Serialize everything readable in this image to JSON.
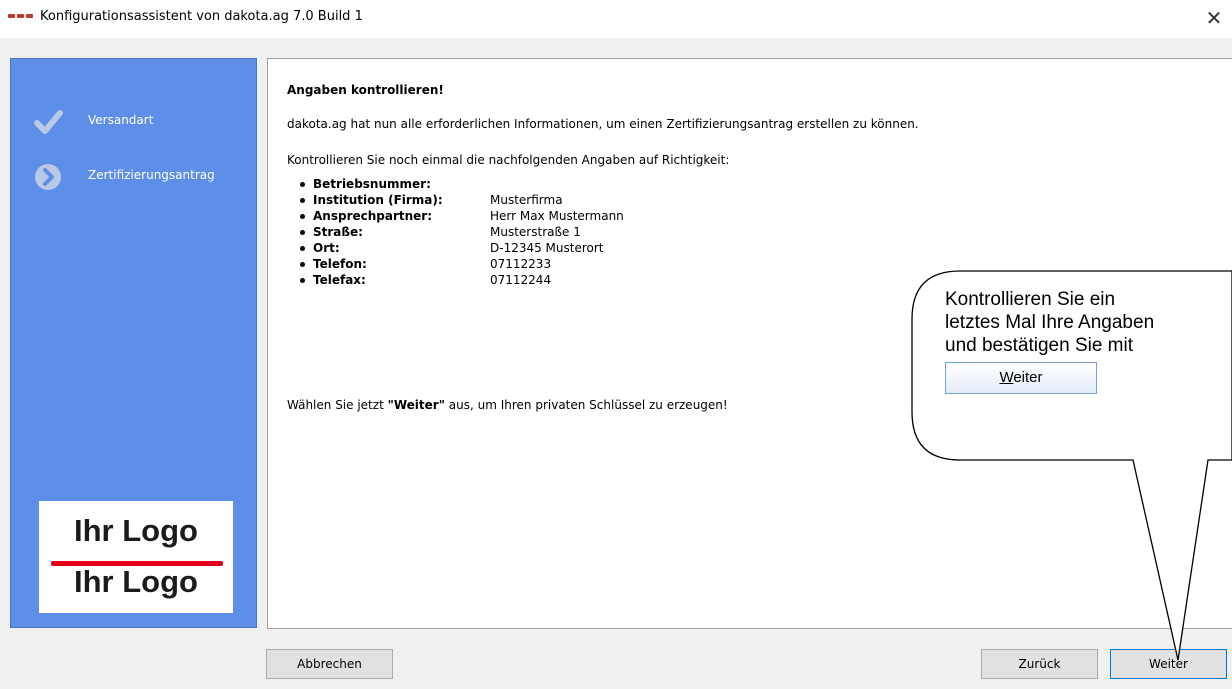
{
  "window": {
    "title": "Konfigurationsassistent von dakota.ag 7.0 Build 1",
    "close_glyph": "✕"
  },
  "sidebar": {
    "steps": [
      {
        "label": "Versandart",
        "state": "done",
        "icon": "checkmark-icon"
      },
      {
        "label": "Zertifizierungsantrag",
        "state": "current",
        "icon": "arrow-circle-icon"
      }
    ],
    "logo": {
      "line1": "Ihr Logo",
      "line2": "Ihr Logo"
    },
    "background_color": "#5d8fe8"
  },
  "content": {
    "heading": "Angaben kontrollieren!",
    "intro": "dakota.ag hat nun alle erforderlichen Informationen, um einen Zertifizierungsantrag erstellen zu können.",
    "check_prompt": "Kontrollieren Sie noch einmal die nachfolgenden Angaben auf Richtigkeit:",
    "details": [
      {
        "key": "Betriebsnummer:",
        "value": ""
      },
      {
        "key": "Institution (Firma):",
        "value": "Musterfirma"
      },
      {
        "key": "Ansprechpartner:",
        "value": "Herr Max Mustermann"
      },
      {
        "key": "Straße:",
        "value": "Musterstraße 1"
      },
      {
        "key": "Ort:",
        "value": "D-12345 Musterort"
      },
      {
        "key": "Telefon:",
        "value": "07112233"
      },
      {
        "key": "Telefax:",
        "value": "07112244"
      }
    ],
    "closing": {
      "before": "Wählen Sie jetzt ",
      "emphasis": "\"Weiter\"",
      "after": " aus, um Ihren privaten Schlüssel zu erzeugen!"
    }
  },
  "buttons": {
    "cancel": "Abbrechen",
    "back": "Zurück",
    "next": "Weiter"
  },
  "callout": {
    "lines": [
      "Kontrollieren Sie ein",
      "letztes Mal Ihre Angaben",
      "und bestätigen Sie mit"
    ],
    "button_mnemonic": "W",
    "button_rest": "eiter"
  }
}
